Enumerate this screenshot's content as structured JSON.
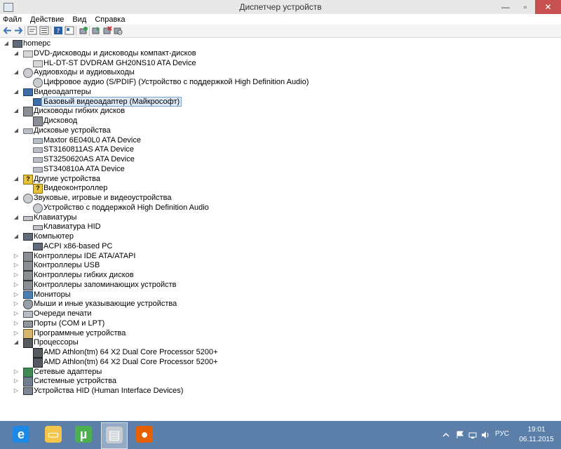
{
  "window": {
    "title": "Диспетчер устройств",
    "controls": {
      "minimize": "—",
      "maximize": "▫",
      "close": "✕"
    }
  },
  "menu": [
    "Файл",
    "Действие",
    "Вид",
    "Справка"
  ],
  "toolbar": [
    "back-icon",
    "forward-icon",
    "properties-icon",
    "list-icon",
    "help-icon",
    "view-icon",
    "refresh-icon",
    "scan-icon",
    "uninstall-icon",
    "disable-icon"
  ],
  "tree": [
    {
      "label": "homepc",
      "level": 0,
      "expanded": true,
      "icon": "computer"
    },
    {
      "label": "DVD-дисководы и дисководы компакт-дисков",
      "level": 1,
      "expanded": true,
      "icon": "cd"
    },
    {
      "label": "HL-DT-ST DVDRAM GH20NS10 ATA Device",
      "level": 2,
      "icon": "cd"
    },
    {
      "label": "Аудиовходы и аудиовыходы",
      "level": 1,
      "expanded": true,
      "icon": "audio"
    },
    {
      "label": "Цифровое аудио (S/PDIF) (Устройство с поддержкой High Definition Audio)",
      "level": 2,
      "icon": "audio"
    },
    {
      "label": "Видеоадаптеры",
      "level": 1,
      "expanded": true,
      "icon": "display"
    },
    {
      "label": "Базовый видеоадаптер (Майкрософт)",
      "level": 2,
      "icon": "display",
      "selected": true
    },
    {
      "label": "Дисководы гибких дисков",
      "level": 1,
      "expanded": true,
      "icon": "floppy"
    },
    {
      "label": "Дисковод",
      "level": 2,
      "icon": "floppy"
    },
    {
      "label": "Дисковые устройства",
      "level": 1,
      "expanded": true,
      "icon": "disk"
    },
    {
      "label": "Maxtor 6E040L0 ATA Device",
      "level": 2,
      "icon": "disk"
    },
    {
      "label": "ST3160811AS ATA Device",
      "level": 2,
      "icon": "disk"
    },
    {
      "label": "ST3250620AS ATA Device",
      "level": 2,
      "icon": "disk"
    },
    {
      "label": "ST340810A ATA Device",
      "level": 2,
      "icon": "disk"
    },
    {
      "label": "Другие устройства",
      "level": 1,
      "expanded": true,
      "icon": "question"
    },
    {
      "label": "Видеоконтроллер",
      "level": 2,
      "icon": "question"
    },
    {
      "label": "Звуковые, игровые и видеоустройства",
      "level": 1,
      "expanded": true,
      "icon": "audio"
    },
    {
      "label": "Устройство с поддержкой High Definition Audio",
      "level": 2,
      "icon": "audio"
    },
    {
      "label": "Клавиатуры",
      "level": 1,
      "expanded": true,
      "icon": "keyboard"
    },
    {
      "label": "Клавиатура HID",
      "level": 2,
      "icon": "keyboard"
    },
    {
      "label": "Компьютер",
      "level": 1,
      "expanded": true,
      "icon": "computer"
    },
    {
      "label": "ACPI x86-based PC",
      "level": 2,
      "icon": "computer"
    },
    {
      "label": "Контроллеры IDE ATA/ATAPI",
      "level": 1,
      "expanded": false,
      "icon": "controller"
    },
    {
      "label": "Контроллеры USB",
      "level": 1,
      "expanded": false,
      "icon": "controller"
    },
    {
      "label": "Контроллеры гибких дисков",
      "level": 1,
      "expanded": false,
      "icon": "controller"
    },
    {
      "label": "Контроллеры запоминающих устройств",
      "level": 1,
      "expanded": false,
      "icon": "controller"
    },
    {
      "label": "Мониторы",
      "level": 1,
      "expanded": false,
      "icon": "monitor"
    },
    {
      "label": "Мыши и иные указывающие устройства",
      "level": 1,
      "expanded": false,
      "icon": "mouse"
    },
    {
      "label": "Очереди печати",
      "level": 1,
      "expanded": false,
      "icon": "print"
    },
    {
      "label": "Порты (COM и LPT)",
      "level": 1,
      "expanded": false,
      "icon": "port"
    },
    {
      "label": "Программные устройства",
      "level": 1,
      "expanded": false,
      "icon": "program"
    },
    {
      "label": "Процессоры",
      "level": 1,
      "expanded": true,
      "icon": "cpu"
    },
    {
      "label": "AMD Athlon(tm) 64 X2 Dual Core Processor 5200+",
      "level": 2,
      "icon": "cpu"
    },
    {
      "label": "AMD Athlon(tm) 64 X2 Dual Core Processor 5200+",
      "level": 2,
      "icon": "cpu"
    },
    {
      "label": "Сетевые адаптеры",
      "level": 1,
      "expanded": false,
      "icon": "network"
    },
    {
      "label": "Системные устройства",
      "level": 1,
      "expanded": false,
      "icon": "system"
    },
    {
      "label": "Устройства HID (Human Interface Devices)",
      "level": 1,
      "expanded": false,
      "icon": "hid"
    }
  ],
  "taskbar": {
    "apps": [
      {
        "name": "internet-explorer-icon",
        "glyph": "e",
        "color": "#1e88e5"
      },
      {
        "name": "file-explorer-icon",
        "glyph": "▭",
        "color": "#f3c54a"
      },
      {
        "name": "utorrent-icon",
        "glyph": "µ",
        "color": "#4caf50"
      },
      {
        "name": "device-manager-icon",
        "glyph": "▤",
        "color": "#c7ccd3",
        "active": true
      },
      {
        "name": "firefox-icon",
        "glyph": "●",
        "color": "#e66000"
      }
    ],
    "tray": {
      "language": "РУС",
      "time": "19:01",
      "date": "06.11.2015"
    }
  }
}
